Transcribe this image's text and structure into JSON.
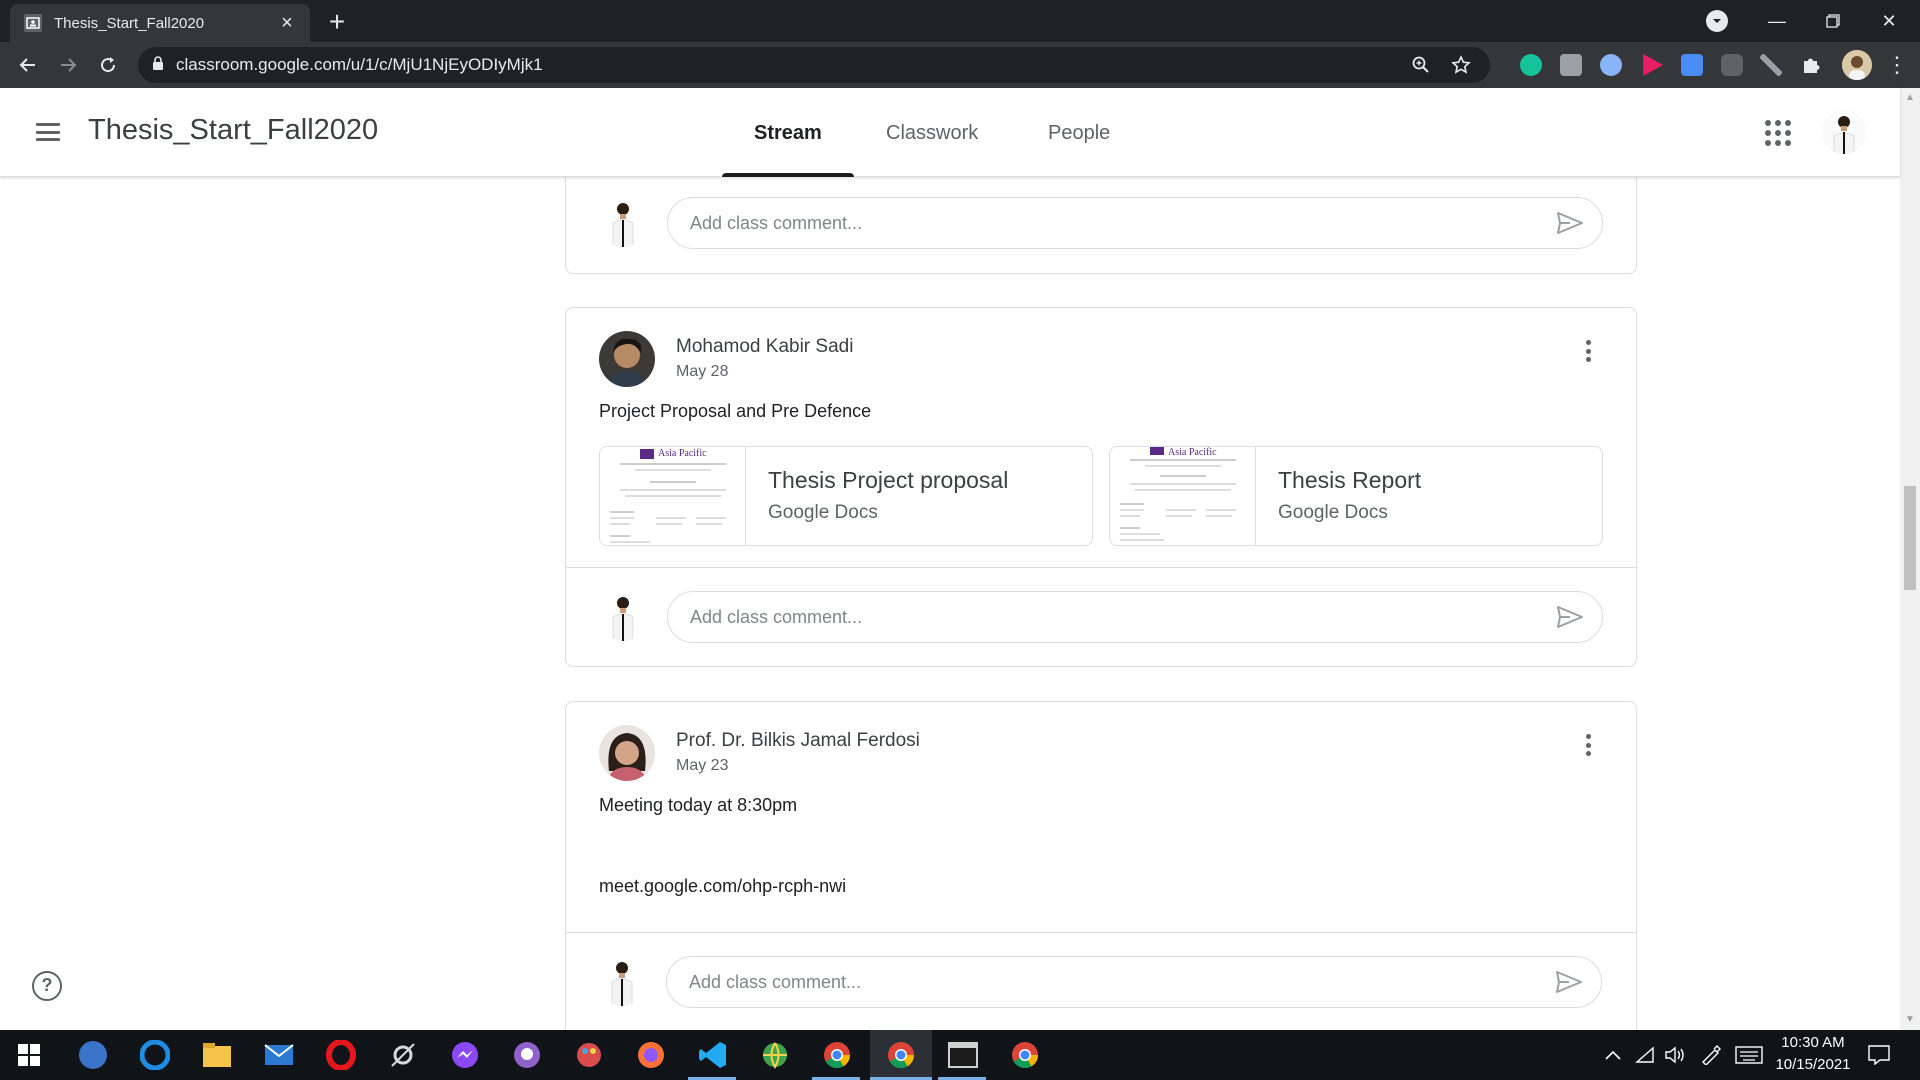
{
  "browser": {
    "tab_title": "Thesis_Start_Fall2020",
    "url": "classroom.google.com/u/1/c/MjU1NjEyODIyMjk1"
  },
  "header": {
    "class_title": "Thesis_Start_Fall2020",
    "tabs": [
      {
        "label": "Stream",
        "active": true
      },
      {
        "label": "Classwork",
        "active": false
      },
      {
        "label": "People",
        "active": false
      }
    ]
  },
  "comment_placeholder": "Add class comment...",
  "posts": [
    {
      "author": "Mohamod Kabir Sadi",
      "date": "May 28",
      "text": "Project Proposal and Pre Defence",
      "attachments": [
        {
          "title": "Thesis Project proposal",
          "type": "Google Docs",
          "thumb_brand": "Asia Pacific"
        },
        {
          "title": "Thesis Report",
          "type": "Google Docs",
          "thumb_brand": "Asia Pacific"
        }
      ]
    },
    {
      "author": "Prof. Dr. Bilkis Jamal Ferdosi",
      "date": "May 23",
      "text": "Meeting today at 8:30pm",
      "link": "meet.google.com/ohp-rcph-nwi"
    }
  ],
  "help_label": "?",
  "taskbar": {
    "time": "10:30 AM",
    "date": "10/15/2021",
    "icons": [
      "windows-start",
      "qbittorrent",
      "edge",
      "file-explorer",
      "mail",
      "opera",
      "satellite-app",
      "messenger",
      "github-desktop",
      "paint-app",
      "firefox",
      "vscode",
      "globe-app",
      "chrome",
      "chrome-active",
      "terminal",
      "chrome-canary"
    ]
  },
  "colors": {
    "chrome_dark": "#202124",
    "chrome_toolbar": "#35363a",
    "border": "#dadce0",
    "text_primary": "#3c4043",
    "text_secondary": "#5f6368",
    "taskbar": "#101419"
  }
}
